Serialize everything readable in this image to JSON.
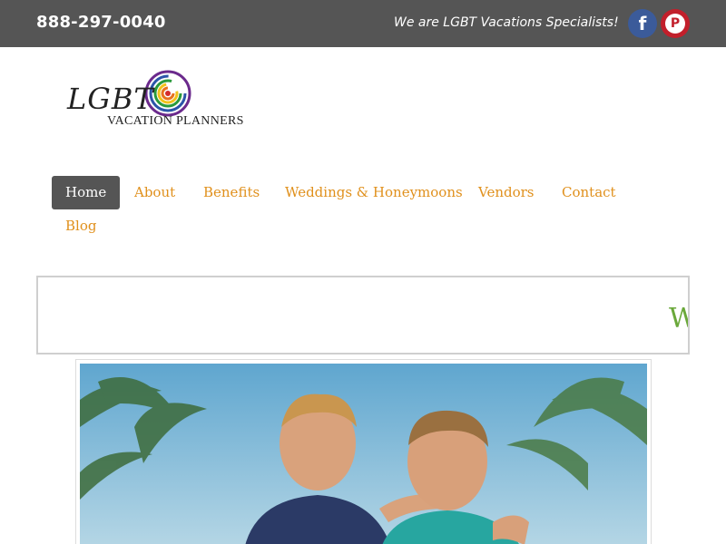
{
  "topbar": {
    "phone": "888-297-0040",
    "tagline": "We are LGBT Vacations Specialists!",
    "facebook_icon": "facebook-icon",
    "pinterest_icon": "pinterest-icon",
    "facebook_glyph": "f",
    "pinterest_glyph": "P"
  },
  "logo": {
    "brand": "LGBT",
    "subtitle": "VACATION PLANNERS"
  },
  "nav": {
    "items": [
      {
        "label": "Home",
        "active": true
      },
      {
        "label": "About"
      },
      {
        "label": "Benefits"
      },
      {
        "label": "Weddings & Honeymoons"
      },
      {
        "label": "Vendors"
      },
      {
        "label": "Contact"
      },
      {
        "label": "Blog"
      }
    ]
  },
  "banner": {
    "text": "W"
  },
  "colors": {
    "topbar": "#555555",
    "nav_link": "#e0901c",
    "banner_text": "#6aa83a",
    "facebook": "#3b5b9a",
    "pinterest": "#c21f2b"
  }
}
